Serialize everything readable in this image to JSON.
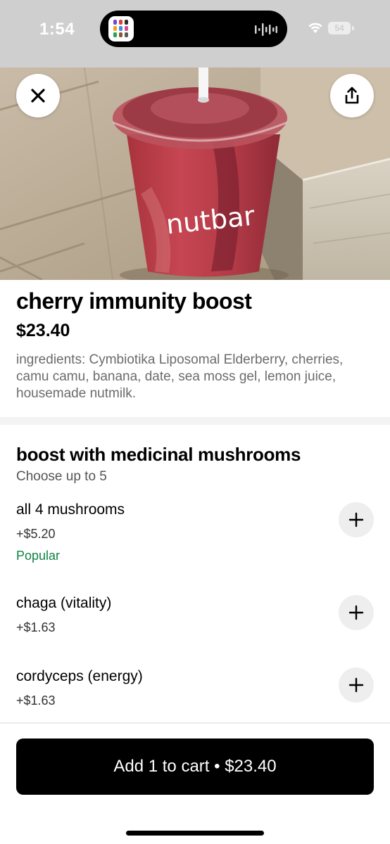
{
  "status_bar": {
    "time": "1:54",
    "battery": "54",
    "icons": [
      "app-grid-icon",
      "audio-wave-icon",
      "wifi-icon",
      "battery-icon"
    ]
  },
  "header": {
    "close_icon": "close-icon",
    "share_icon": "share-icon"
  },
  "hero": {
    "cup_brand": "nutbar"
  },
  "product": {
    "title": "cherry immunity boost",
    "price": "$23.40",
    "description": "ingredients: Cymbiotika Liposomal Elderberry, cherries, camu camu, banana, date, sea moss gel, lemon juice, housemade nutmilk."
  },
  "options_section": {
    "title": "boost with medicinal mushrooms",
    "subtitle": "Choose up to 5",
    "items": [
      {
        "name": "all 4 mushrooms",
        "price": "+$5.20",
        "badge": "Popular"
      },
      {
        "name": "chaga (vitality)",
        "price": "+$1.63"
      },
      {
        "name": "cordyceps (energy)",
        "price": "+$1.63"
      }
    ]
  },
  "cart": {
    "label": "Add 1 to cart • $23.40"
  },
  "colors": {
    "accent_green": "#0e8345",
    "button_black": "#000000",
    "muted_text": "#6b6b6b"
  }
}
